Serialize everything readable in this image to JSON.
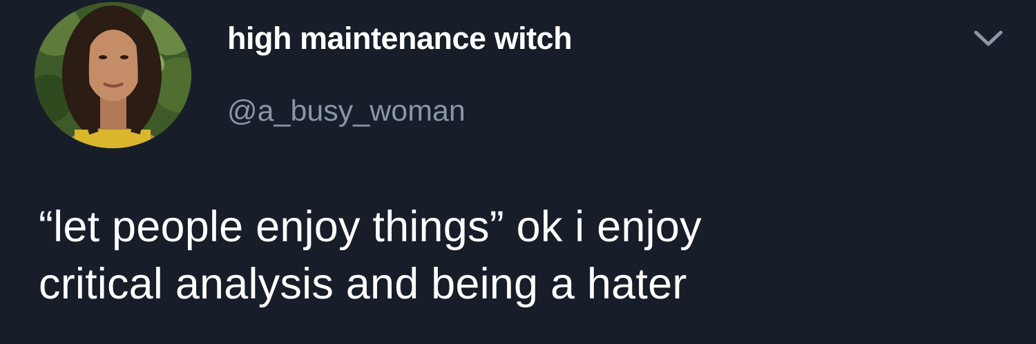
{
  "tweet": {
    "author": {
      "display_name": "high maintenance witch",
      "handle": "@a_busy_woman",
      "avatar_icon": "profile-photo"
    },
    "menu_icon": "chevron-down-icon",
    "text_lines": [
      "“let people enjoy things” ok i enjoy",
      "critical analysis and being a hater"
    ]
  },
  "colors": {
    "background": "#171d29",
    "text_primary": "#ffffff",
    "text_secondary": "#8a96a3",
    "icon_muted": "#8a96a3"
  }
}
